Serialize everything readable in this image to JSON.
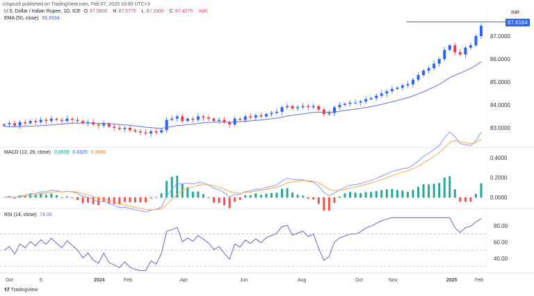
{
  "header": {
    "published": "crispus9 published on TradingView.com, Feb 07, 2025 10:00 UTC+3"
  },
  "symbol": {
    "title": "U.S. Dollar / Indian Rupee, 1D, ICE",
    "o_label": "O",
    "o": "87.5800",
    "h_label": "H",
    "h": "87.5775",
    "l_label": "L",
    "l": "87.3300",
    "c_label": "C",
    "c": "87.4275",
    "vol": "Vol0"
  },
  "ema": {
    "label": "EMA (50, close)",
    "value": "85.9334"
  },
  "macd": {
    "label": "MACD (12, 26, close)",
    "hist": "0.0639",
    "macd": "0.4325",
    "signal": "0.3686",
    "ticks": [
      "0.4000",
      "0.2000",
      "0.0000"
    ]
  },
  "rsi": {
    "label": "RSI (14, close)",
    "value": "74.00",
    "ticks": [
      "80.00",
      "60.00",
      "40.00"
    ]
  },
  "currency": "INR",
  "last_price": "87.6164",
  "price_ticks": [
    "87.0000",
    "86.0000",
    "85.0000",
    "84.0000",
    "83.0000"
  ],
  "time_ticks": [
    "Oct",
    "6",
    "2024",
    "Feb",
    "Apr",
    "Jun",
    "Aug",
    "Oct",
    "Nov",
    "2025",
    "Feb"
  ],
  "footer": {
    "logo": "TradingView"
  },
  "colors": {
    "up": "#2962ff",
    "down": "#f23645",
    "ema": "#5b6cf9",
    "macd": "#7f9cf5",
    "signal": "#ffa54a",
    "hist_up": "#26a69a",
    "hist_down": "#ef5350",
    "rsi": "#7e57c2"
  },
  "chart_data": {
    "type": "candlestick",
    "title": "USD/INR 1D",
    "ylim": [
      82.5,
      87.7
    ],
    "closes": [
      83.15,
      83.2,
      83.1,
      83.25,
      83.2,
      83.3,
      83.25,
      83.35,
      83.3,
      83.4,
      83.35,
      83.3,
      83.4,
      83.35,
      83.3,
      83.2,
      83.25,
      83.15,
      83.1,
      83.2,
      83.05,
      83.0,
      82.95,
      83.0,
      82.9,
      82.85,
      82.8,
      82.75,
      82.85,
      82.8,
      82.9,
      83.35,
      83.4,
      83.5,
      83.3,
      83.4,
      83.35,
      83.5,
      83.45,
      83.4,
      83.3,
      83.35,
      83.25,
      83.15,
      83.4,
      83.35,
      83.5,
      83.45,
      83.55,
      83.5,
      83.6,
      83.65,
      83.7,
      83.9,
      83.95,
      83.85,
      83.9,
      83.95,
      83.9,
      83.95,
      83.8,
      83.6,
      83.65,
      83.9,
      84.0,
      84.05,
      84.1,
      84.1,
      84.15,
      84.25,
      84.3,
      84.4,
      84.5,
      84.6,
      84.7,
      84.75,
      84.85,
      84.9,
      85.1,
      85.3,
      85.5,
      85.6,
      85.8,
      86.0,
      86.4,
      86.6,
      86.3,
      86.2,
      86.5,
      86.6,
      87.0,
      87.45
    ]
  }
}
